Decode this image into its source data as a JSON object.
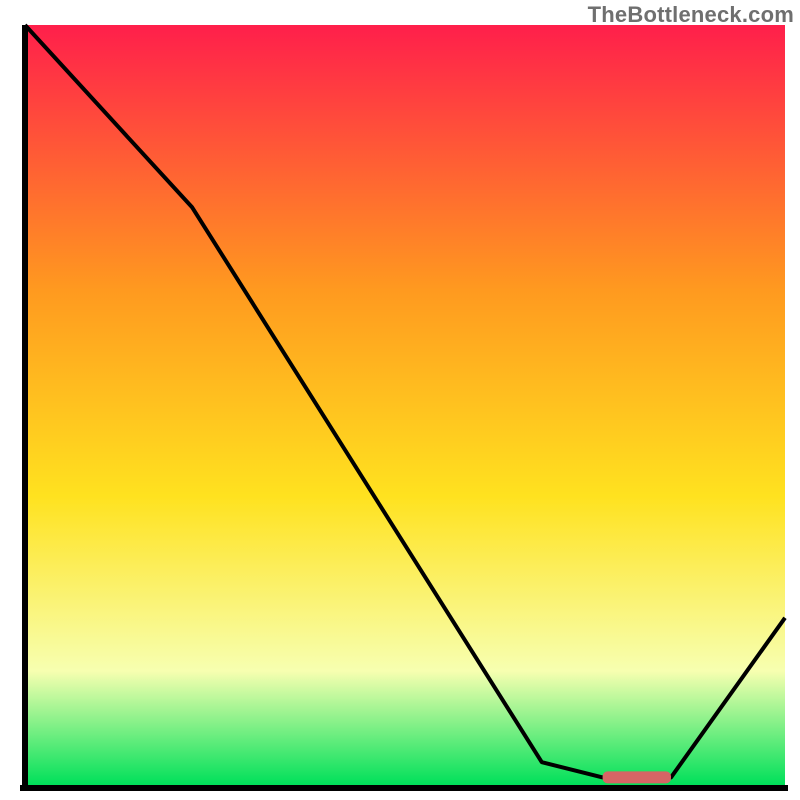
{
  "watermark": "TheBottleneck.com",
  "chart_data": {
    "type": "line",
    "title": "",
    "xlabel": "",
    "ylabel": "",
    "xlim": [
      0,
      100
    ],
    "ylim": [
      0,
      100
    ],
    "grid": false,
    "series": [
      {
        "name": "bottleneck-curve",
        "x": [
          0,
          22,
          68,
          76,
          85,
          100
        ],
        "values": [
          100,
          76,
          3,
          1,
          1,
          22
        ]
      }
    ],
    "marker": {
      "name": "optimal-zone",
      "x_start": 76,
      "x_end": 85,
      "y": 1,
      "color": "#d66565"
    },
    "background_gradient": {
      "top_color": "#ff1f4b",
      "mid_upper_color": "#ff9a1f",
      "mid_color": "#ffe21f",
      "mid_lower_color": "#f7ffb0",
      "bottom_color": "#00e05a"
    }
  }
}
